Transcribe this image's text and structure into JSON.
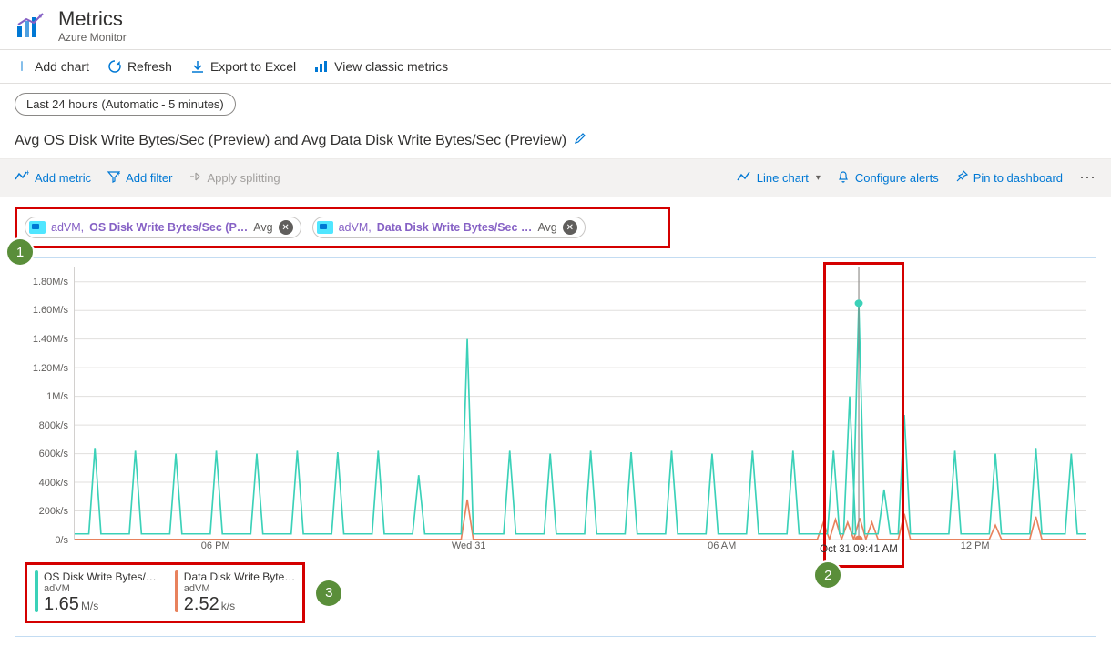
{
  "header": {
    "title": "Metrics",
    "subtitle": "Azure Monitor"
  },
  "toolbar": {
    "add_chart": "Add chart",
    "refresh": "Refresh",
    "export": "Export to Excel",
    "classic": "View classic metrics"
  },
  "time_range": "Last 24 hours (Automatic - 5 minutes)",
  "chart_title": "Avg OS Disk Write Bytes/Sec (Preview) and Avg Data Disk Write Bytes/Sec (Preview)",
  "chart_toolbar": {
    "add_metric": "Add metric",
    "add_filter": "Add filter",
    "apply_split": "Apply splitting",
    "chart_type": "Line chart",
    "configure_alerts": "Configure alerts",
    "pin": "Pin to dashboard"
  },
  "metric_chips": [
    {
      "resource": "adVM,",
      "metric": "OS Disk Write Bytes/Sec (P…",
      "agg": "Avg"
    },
    {
      "resource": "adVM,",
      "metric": "Data Disk Write Bytes/Sec …",
      "agg": "Avg"
    }
  ],
  "hover_time": "Oct 31 09:41 AM",
  "readouts": [
    {
      "metric": "OS Disk Write Bytes/…",
      "resource": "adVM",
      "value": "1.65",
      "unit": "M/s"
    },
    {
      "metric": "Data Disk Write Byte…",
      "resource": "adVM",
      "value": "2.52",
      "unit": "k/s"
    }
  ],
  "annotations": {
    "b1": "1",
    "b2": "2",
    "b3": "3"
  },
  "chart_data": {
    "type": "line",
    "xlabel": "",
    "ylabel": "",
    "ylim": [
      0,
      1900000
    ],
    "y_ticks": [
      {
        "v": 0,
        "label": "0/s"
      },
      {
        "v": 200000,
        "label": "200k/s"
      },
      {
        "v": 400000,
        "label": "400k/s"
      },
      {
        "v": 600000,
        "label": "600k/s"
      },
      {
        "v": 800000,
        "label": "800k/s"
      },
      {
        "v": 1000000,
        "label": "1M/s"
      },
      {
        "v": 1200000,
        "label": "1.20M/s"
      },
      {
        "v": 1400000,
        "label": "1.40M/s"
      },
      {
        "v": 1600000,
        "label": "1.60M/s"
      },
      {
        "v": 1800000,
        "label": "1.80M/s"
      }
    ],
    "x_ticks": [
      {
        "f": 0.14,
        "label": "06 PM"
      },
      {
        "f": 0.39,
        "label": "Wed 31"
      },
      {
        "f": 0.64,
        "label": "06 AM"
      },
      {
        "f": 0.89,
        "label": "12 PM"
      }
    ],
    "cursor": {
      "f": 0.775,
      "series1_value": 1650000,
      "series2_value": 2520
    },
    "series": [
      {
        "name": "OS Disk Write Bytes/Sec (Preview), adVM, Avg",
        "color": "#3bd1b8",
        "baseline": 40000,
        "spikes": [
          {
            "f": 0.02,
            "v": 640000
          },
          {
            "f": 0.06,
            "v": 620000
          },
          {
            "f": 0.1,
            "v": 600000
          },
          {
            "f": 0.14,
            "v": 620000
          },
          {
            "f": 0.18,
            "v": 600000
          },
          {
            "f": 0.22,
            "v": 620000
          },
          {
            "f": 0.26,
            "v": 610000
          },
          {
            "f": 0.3,
            "v": 620000
          },
          {
            "f": 0.34,
            "v": 450000
          },
          {
            "f": 0.388,
            "v": 1400000
          },
          {
            "f": 0.43,
            "v": 620000
          },
          {
            "f": 0.47,
            "v": 600000
          },
          {
            "f": 0.51,
            "v": 620000
          },
          {
            "f": 0.55,
            "v": 610000
          },
          {
            "f": 0.59,
            "v": 620000
          },
          {
            "f": 0.63,
            "v": 600000
          },
          {
            "f": 0.67,
            "v": 620000
          },
          {
            "f": 0.71,
            "v": 620000
          },
          {
            "f": 0.75,
            "v": 620000
          },
          {
            "f": 0.766,
            "v": 1000000
          },
          {
            "f": 0.775,
            "v": 1650000
          },
          {
            "f": 0.8,
            "v": 350000
          },
          {
            "f": 0.82,
            "v": 870000
          },
          {
            "f": 0.87,
            "v": 620000
          },
          {
            "f": 0.91,
            "v": 600000
          },
          {
            "f": 0.95,
            "v": 640000
          },
          {
            "f": 0.985,
            "v": 600000
          }
        ]
      },
      {
        "name": "Data Disk Write Bytes/Sec (Preview), adVM, Avg",
        "color": "#e8825d",
        "baseline": 2000,
        "spikes": [
          {
            "f": 0.388,
            "v": 280000
          },
          {
            "f": 0.74,
            "v": 120000
          },
          {
            "f": 0.752,
            "v": 140000
          },
          {
            "f": 0.764,
            "v": 120000
          },
          {
            "f": 0.776,
            "v": 150000
          },
          {
            "f": 0.788,
            "v": 120000
          },
          {
            "f": 0.82,
            "v": 180000
          },
          {
            "f": 0.91,
            "v": 100000
          },
          {
            "f": 0.95,
            "v": 160000
          }
        ]
      }
    ]
  }
}
